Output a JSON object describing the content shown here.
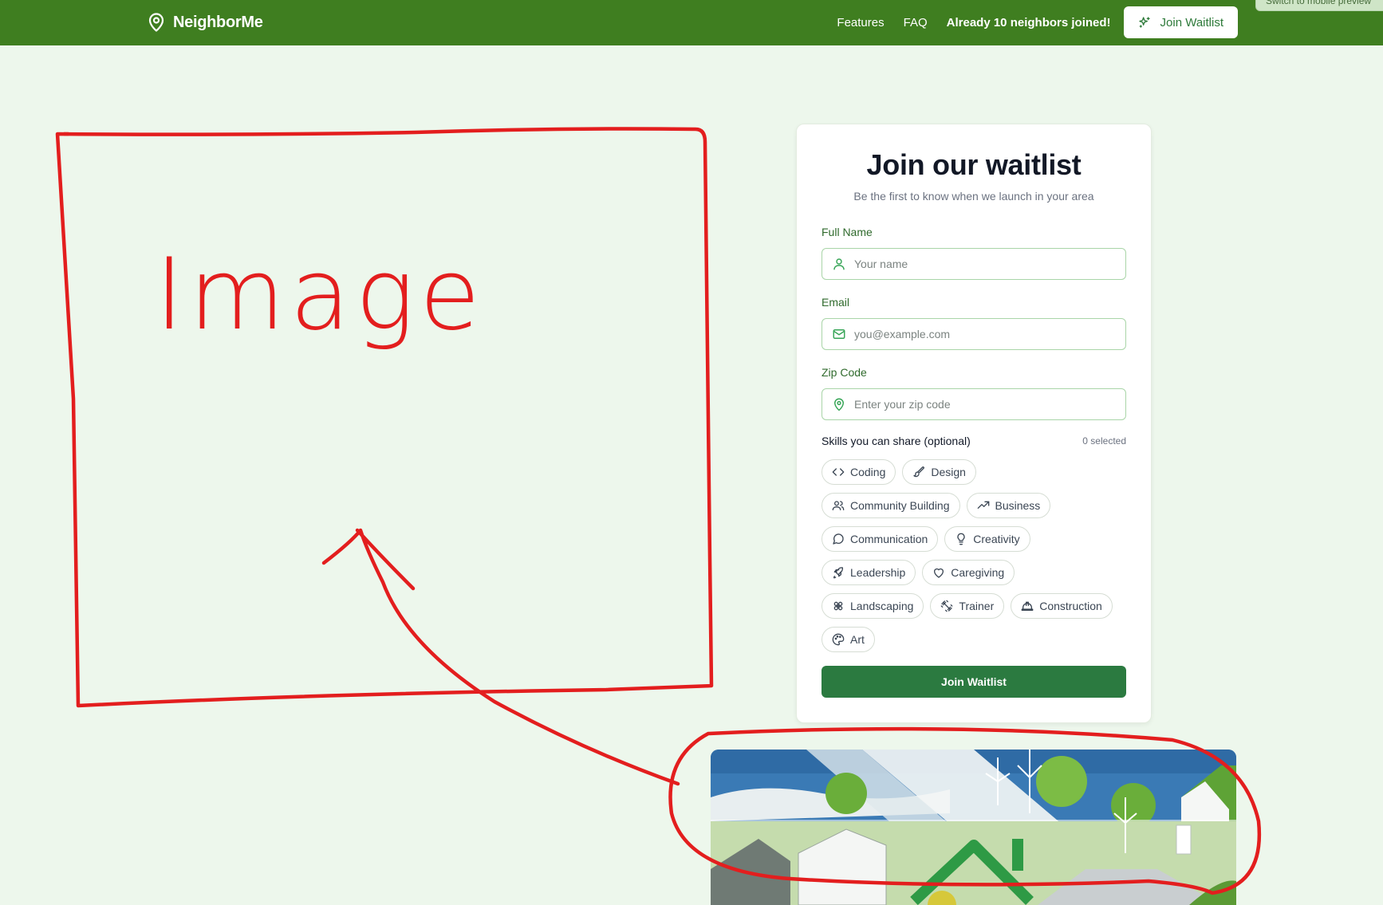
{
  "nav": {
    "brand": "NeighborMe",
    "features": "Features",
    "faq": "FAQ",
    "joined_prefix": "Already ",
    "joined_count": "10",
    "joined_suffix": " neighbors joined!",
    "join_button": "Join Waitlist",
    "mobile_preview": "Switch to mobile preview"
  },
  "form": {
    "title": "Join our waitlist",
    "subtitle": "Be the first to know when we launch in your area",
    "name_label": "Full Name",
    "name_placeholder": "Your name",
    "email_label": "Email",
    "email_placeholder": "you@example.com",
    "zip_label": "Zip Code",
    "zip_placeholder": "Enter your zip code",
    "skills_label": "Skills you can share (optional)",
    "skills_selected": "0 selected",
    "skills": [
      {
        "label": "Coding",
        "icon": "code-icon"
      },
      {
        "label": "Design",
        "icon": "brush-icon"
      },
      {
        "label": "Community Building",
        "icon": "users-icon"
      },
      {
        "label": "Business",
        "icon": "trending-up-icon"
      },
      {
        "label": "Communication",
        "icon": "message-circle-icon"
      },
      {
        "label": "Creativity",
        "icon": "lightbulb-icon"
      },
      {
        "label": "Leadership",
        "icon": "rocket-icon"
      },
      {
        "label": "Caregiving",
        "icon": "heart-icon"
      },
      {
        "label": "Landscaping",
        "icon": "flower-icon"
      },
      {
        "label": "Trainer",
        "icon": "dumbbell-icon"
      },
      {
        "label": "Construction",
        "icon": "hard-hat-icon"
      },
      {
        "label": "Art",
        "icon": "palette-icon"
      }
    ],
    "submit": "Join Waitlist"
  },
  "annotation": {
    "text": "Image",
    "color": "#e31e1e"
  },
  "colors": {
    "nav_bg": "#3f7e20",
    "page_bg": "#edf7ec",
    "primary_button": "#2b7a40",
    "accent_green": "#2e9a45"
  }
}
